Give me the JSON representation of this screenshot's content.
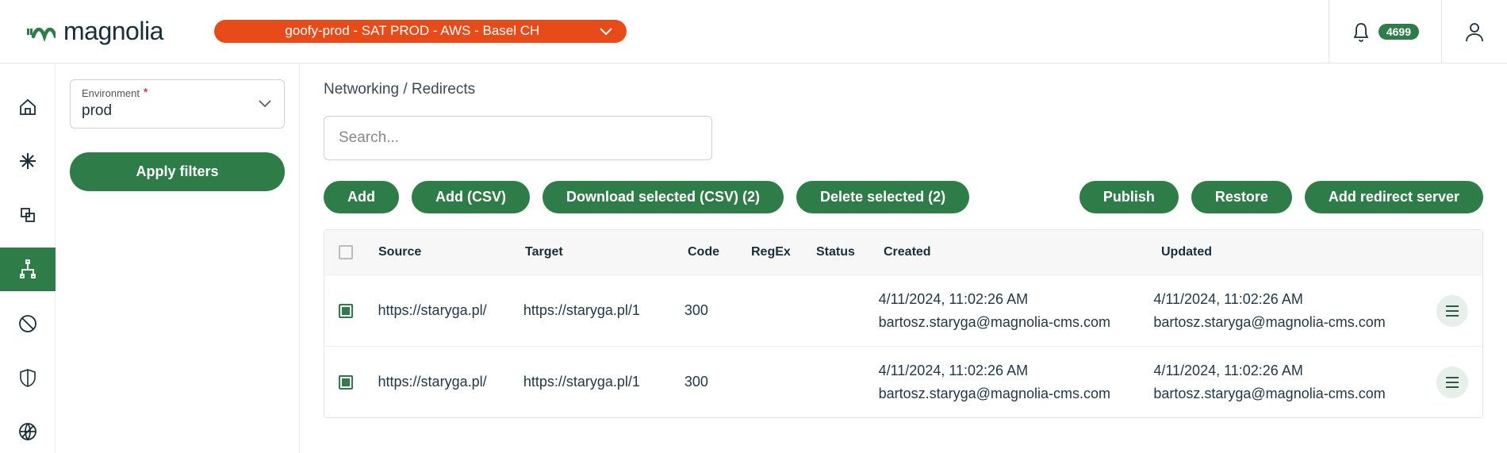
{
  "header": {
    "brand": "magnolia",
    "env_pill": "goofy-prod - SAT PROD - AWS - Basel CH",
    "notif_count": "4699"
  },
  "sidebar": {
    "env_label": "Environment",
    "env_value": "prod",
    "apply_label": "Apply filters"
  },
  "breadcrumb": "Networking / Redirects",
  "search": {
    "placeholder": "Search..."
  },
  "buttons": {
    "add": "Add",
    "add_csv": "Add (CSV)",
    "download": "Download selected (CSV) (2)",
    "delete": "Delete selected (2)",
    "publish": "Publish",
    "restore": "Restore",
    "add_server": "Add redirect server"
  },
  "table": {
    "headers": {
      "source": "Source",
      "target": "Target",
      "code": "Code",
      "regex": "RegEx",
      "status": "Status",
      "created": "Created",
      "updated": "Updated"
    },
    "rows": [
      {
        "source": "https://staryga.pl/",
        "target": "https://staryga.pl/1",
        "code": "300",
        "regex": "",
        "status": "",
        "created_date": "4/11/2024, 11:02:26 AM",
        "created_by": "bartosz.staryga@magnolia-cms.com",
        "updated_date": "4/11/2024, 11:02:26 AM",
        "updated_by": "bartosz.staryga@magnolia-cms.com"
      },
      {
        "source": "https://staryga.pl/",
        "target": "https://staryga.pl/1",
        "code": "300",
        "regex": "",
        "status": "",
        "created_date": "4/11/2024, 11:02:26 AM",
        "created_by": "bartosz.staryga@magnolia-cms.com",
        "updated_date": "4/11/2024, 11:02:26 AM",
        "updated_by": "bartosz.staryga@magnolia-cms.com"
      }
    ]
  }
}
